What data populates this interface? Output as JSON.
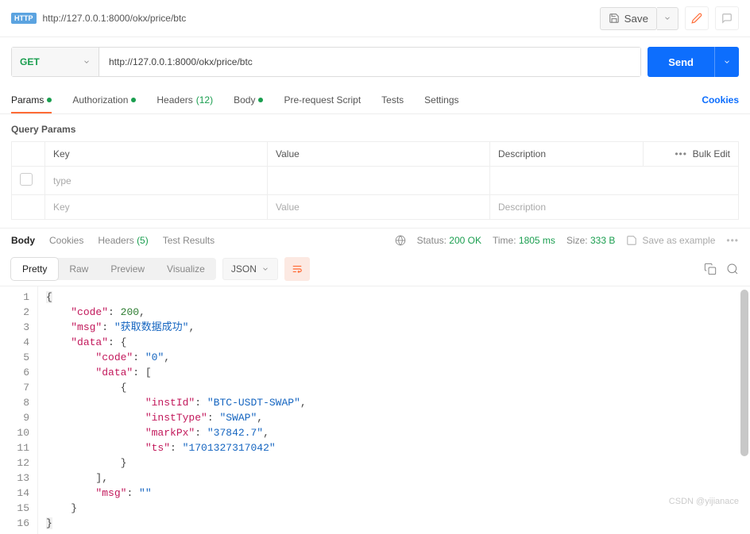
{
  "header": {
    "badge": "HTTP",
    "url": "http://127.0.0.1:8000/okx/price/btc",
    "save": "Save"
  },
  "request": {
    "method": "GET",
    "url": "http://127.0.0.1:8000/okx/price/btc",
    "send": "Send"
  },
  "tabs": {
    "params": "Params",
    "authorization": "Authorization",
    "headers": "Headers",
    "headers_count": "(12)",
    "body": "Body",
    "prerequest": "Pre-request Script",
    "tests": "Tests",
    "settings": "Settings",
    "cookies": "Cookies"
  },
  "query_params": {
    "title": "Query Params",
    "headers": {
      "key": "Key",
      "value": "Value",
      "description": "Description",
      "bulk_edit": "Bulk Edit"
    },
    "rows": [
      {
        "key": "type",
        "value": "",
        "description": ""
      },
      {
        "key": "Key",
        "value": "Value",
        "description": "Description"
      }
    ]
  },
  "response": {
    "tabs": {
      "body": "Body",
      "cookies": "Cookies",
      "headers": "Headers",
      "headers_count": "(5)",
      "test_results": "Test Results"
    },
    "status_label": "Status:",
    "status_value": "200 OK",
    "time_label": "Time:",
    "time_value": "1805 ms",
    "size_label": "Size:",
    "size_value": "333 B",
    "save_example": "Save as example"
  },
  "view": {
    "pretty": "Pretty",
    "raw": "Raw",
    "preview": "Preview",
    "visualize": "Visualize",
    "format": "JSON"
  },
  "code_lines": 16,
  "json_body": {
    "code": 200,
    "msg": "获取数据成功",
    "data": {
      "code": "0",
      "data": [
        {
          "instId": "BTC-USDT-SWAP",
          "instType": "SWAP",
          "markPx": "37842.7",
          "ts": "1701327317042"
        }
      ],
      "msg": ""
    }
  },
  "watermark": "CSDN @yijianace"
}
